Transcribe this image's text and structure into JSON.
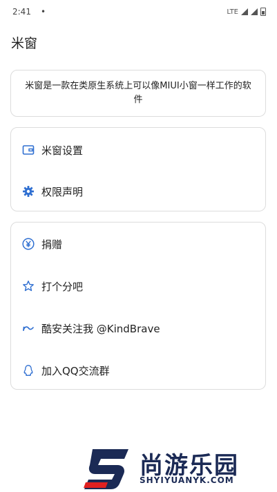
{
  "status_bar": {
    "time": "2:41",
    "dot": "•",
    "network": "LTE"
  },
  "app": {
    "title": "米窗"
  },
  "intro": {
    "text": "米窗是一款在类原生系统上可以像MIUI小窗一样工作的软件"
  },
  "settings_card": {
    "items": [
      {
        "label": "米窗设置",
        "icon": "window-settings-icon"
      },
      {
        "label": "权限声明",
        "icon": "gear-icon"
      }
    ]
  },
  "support_card": {
    "items": [
      {
        "label": "捐赠",
        "icon": "yen-icon"
      },
      {
        "label": "打个分吧",
        "icon": "star-icon"
      },
      {
        "label": "酷安关注我 @KindBrave",
        "icon": "coolapk-icon"
      },
      {
        "label": "加入QQ交流群",
        "icon": "qq-icon"
      }
    ]
  },
  "watermark": {
    "cn": "尚游乐园",
    "en": "SHYIYUANYK.COM"
  },
  "colors": {
    "accent": "#2f6fd1",
    "border": "#dcdcdc",
    "watermark_red": "#e02020",
    "watermark_navy": "#1b2a55"
  }
}
